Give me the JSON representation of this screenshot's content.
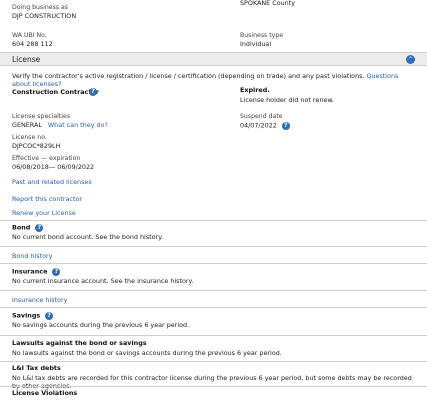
{
  "top": {
    "dba_label": "Doing business as",
    "dba_value": "DJP CONSTRUCTION",
    "county_value": "SPOKANE County",
    "ubi_label": "WA UBI No.",
    "ubi_value": "604 288 112",
    "business_type_label": "Business type",
    "business_type_value": "Individual"
  },
  "license": {
    "section_title": "License",
    "collapse_icon": "chevron-up-icon",
    "intro_text": "Verify the contractor's active registration / license / certification (depending on trade) and any past violations.",
    "intro_link": "Questions about licenses?",
    "type_label": "Construction Contractor",
    "status": "Expired.",
    "status_note": "License holder did not renew.",
    "specialties_label": "License specialties",
    "specialties_value": "GENERAL",
    "specialties_link": "What can they do?",
    "suspend_label": "Suspend date",
    "suspend_value": "04/07/2022",
    "number_label": "License no.",
    "number_value": "DJPCOC*829LH",
    "effective_label": "Effective — expiration",
    "effective_value": "06/08/2018— 06/09/2022",
    "past_link": "Past and related licenses",
    "report_link": "Report this contractor",
    "renew_link": "Renew your License"
  },
  "bond": {
    "title": "Bond",
    "text": "No current bond account. See the bond history.",
    "link": "Bond history"
  },
  "insurance": {
    "title": "Insurance",
    "text": "No current insurance account. See the insurance history.",
    "link": "Insurance history"
  },
  "savings": {
    "title": "Savings",
    "text": "No savings accounts during the previous 6 year period."
  },
  "lawsuits": {
    "title": "Lawsuits against the bond or savings",
    "text": "No lawsuits against the bond or savings accounts during the previous 6 year period."
  },
  "tax": {
    "title": "L&I Tax debts",
    "text": "No L&I tax debts are recorded for this contractor license during the previous 6 year period, but some debts may be recorded by other agencies."
  },
  "violations": {
    "title": "License Violations"
  },
  "colors": {
    "link": "#2a62a8",
    "help_icon": "#2f6fb5",
    "header_bg": "#ececec"
  }
}
